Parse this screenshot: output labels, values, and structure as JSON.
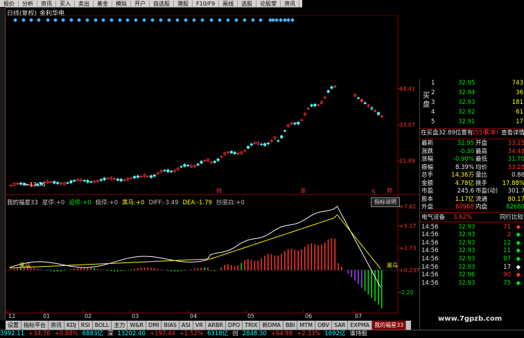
{
  "toolbar": [
    "报价",
    "分析",
    "资讯",
    "买入",
    "卖出",
    "基金",
    "模拟",
    "开户",
    "自选股",
    "港股",
    "F10/F9",
    "画线",
    "选股",
    "论股堂",
    "资讯"
  ],
  "chart_header": {
    "period": "日线(复权)",
    "stock": "金利华电"
  },
  "price_axis": [
    "44.41",
    "33.07",
    "21.89"
  ],
  "price_low_marker": "13.36",
  "event_markers": [
    "财",
    "涨",
    "q",
    "转"
  ],
  "indicator": {
    "name": "我的福星33",
    "items": [
      {
        "label": "星停:",
        "value": "+0",
        "color": "#c0c0c0"
      },
      {
        "label": "追停:",
        "value": "+0",
        "color": "#00e600"
      },
      {
        "label": "极停:",
        "value": "+0",
        "color": "#c0c0c0"
      },
      {
        "label": "黑马:",
        "value": "+0",
        "color": "#ffff00"
      },
      {
        "label": "DIFF:",
        "value": "-3.49",
        "color": "#c0c0c0"
      },
      {
        "label": "DEA:",
        "value": "-1.79",
        "color": "#ffff00"
      },
      {
        "label": "抄底白:",
        "value": "+0",
        "color": "#c0c0c0"
      }
    ],
    "help": "指标说明",
    "axis": [
      "+7.61",
      "+5.17",
      "+2.73",
      "+0.237",
      "-2.20"
    ],
    "black_horse_left": "黑马",
    "black_horse_right": "黑马"
  },
  "x_axis": [
    "12",
    "01",
    "02",
    "03",
    "04",
    "05",
    "06",
    "07"
  ],
  "tabs": [
    "设置",
    "指标平台",
    "资讯",
    "KDJ",
    "RSI",
    "BOLL",
    "主力",
    "W&R",
    "DMI",
    "BIAS",
    "ASI",
    "VR",
    "ARBR",
    "DPO",
    "TRIX",
    "新DMA",
    "BBI",
    "MTM",
    "OBV",
    "SAR",
    "EXPMA",
    "我的福星33"
  ],
  "active_tab": "我的福星33",
  "status": [
    {
      "text": "3992.11",
      "color": "#00ffff"
    },
    {
      "text": "+34.76",
      "color": "#ff3232"
    },
    {
      "text": "+0.88%",
      "color": "#ff3232"
    },
    {
      "text": "6883亿",
      "color": "#00ffff"
    },
    {
      "text": "深",
      "color": "#e8e8e8"
    },
    {
      "text": "13202.40",
      "color": "#00ffff"
    },
    {
      "text": "+197.44",
      "color": "#ff3232"
    },
    {
      "text": "+1.52%",
      "color": "#ff3232"
    },
    {
      "text": "6318亿",
      "color": "#00ffff"
    },
    {
      "text": "创",
      "color": "#e8e8e8"
    },
    {
      "text": "2848.30",
      "color": "#00ffff"
    },
    {
      "text": "+64.98",
      "color": "#ff3232"
    },
    {
      "text": "+2.33%",
      "color": "#ff3232"
    },
    {
      "text": "1692亿",
      "color": "#00ffff"
    },
    {
      "text": "谁持股",
      "color": "#e8e8e8"
    }
  ],
  "order_book": {
    "side_label": "买盘",
    "rows": [
      {
        "n": "1",
        "price": "32.95",
        "vol": "743"
      },
      {
        "n": "2",
        "price": "32.94",
        "vol": "36"
      },
      {
        "n": "3",
        "price": "32.93",
        "vol": "181"
      },
      {
        "n": "4",
        "price": "32.92",
        "vol": "61"
      },
      {
        "n": "5",
        "price": "32.91",
        "vol": "17"
      }
    ]
  },
  "notice": {
    "text": "在买盘32.89位置有",
    "vol": "355手",
    "action": "买单!",
    "link": "查看详情"
  },
  "quote": [
    {
      "l": "最新",
      "v": "32.95",
      "vc": "#00e600",
      "l2": "开盘",
      "v2": "33.25",
      "v2c": "#ff3232"
    },
    {
      "l": "涨跌",
      "v": "-0.30",
      "vc": "#00e600",
      "l2": "最高",
      "v2": "34.49",
      "v2c": "#ff3232"
    },
    {
      "l": "涨幅",
      "v": "-0.90%",
      "vc": "#00e600",
      "l2": "最低",
      "v2": "31.70",
      "v2c": "#00e600"
    },
    {
      "l": "振幅",
      "v": "8.39%",
      "vc": "#e8e8e8",
      "l2": "均价",
      "v2": "33.28",
      "v2c": "#ff3232"
    },
    {
      "l": "总手",
      "v": "14.36万",
      "vc": "#ffff00",
      "l2": "量比",
      "v2": "0.86",
      "v2c": "#e8e8e8"
    },
    {
      "l": "金额",
      "v": "4.78亿",
      "vc": "#ffff00",
      "l2": "换手",
      "v2": "17.88%",
      "v2c": "#ffff00"
    },
    {
      "l": "市盈",
      "v": "245.6",
      "vc": "#e8e8e8",
      "l2": "市盈(动)",
      "v2": "301.7",
      "v2c": "#e8e8e8"
    },
    {
      "l": "股本",
      "v": "1.17亿",
      "vc": "#ffff00",
      "l2": "流通",
      "v2": "80.17",
      "v2c": "#ffff00"
    },
    {
      "l": "外盘",
      "v": "60968",
      "vc": "#ff3232",
      "l2": "内盘",
      "v2": "82660",
      "v2c": "#00e600"
    }
  ],
  "sector": {
    "name": "电气设备",
    "pct": "3.62%",
    "link": "同行比较"
  },
  "ticks": [
    {
      "t": "14:56",
      "p": "32.93",
      "v": "71",
      "vc": "#ff3232",
      "arrow": "◆",
      "ac": "#ff3232"
    },
    {
      "t": "14:56",
      "p": "32.93",
      "v": "2",
      "vc": "#ff3232",
      "arrow": "◆",
      "ac": "#00e600"
    },
    {
      "t": "14:56",
      "p": "32.93",
      "v": "12",
      "vc": "#00e600",
      "arrow": "◆",
      "ac": "#00e600"
    },
    {
      "t": "14:56",
      "p": "32.93",
      "v": "11",
      "vc": "#00e600",
      "arrow": "◆",
      "ac": "#00e600"
    },
    {
      "t": "14:56",
      "p": "32.93",
      "v": "87",
      "vc": "#00e600",
      "arrow": "◆",
      "ac": "#00e600"
    },
    {
      "t": "14:56",
      "p": "32.93",
      "v": "17",
      "vc": "#e8e8e8",
      "arrow": "◆",
      "ac": "#e8e8e8"
    },
    {
      "t": "14:56",
      "p": "32.96",
      "v": "90",
      "vc": "#ff3232",
      "arrow": "◆",
      "ac": "#ff3232"
    },
    {
      "t": "14:56",
      "p": "32.93",
      "v": "75",
      "vc": "#00e600",
      "arrow": "◆",
      "ac": "#00e600"
    }
  ],
  "watermark": "www.7gpzb.com"
}
